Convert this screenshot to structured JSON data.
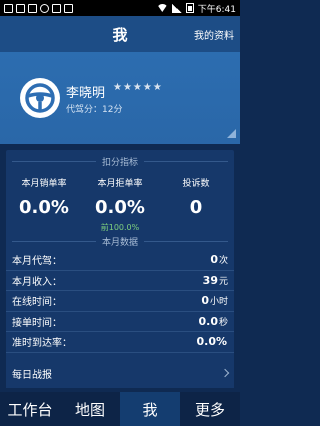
{
  "status_bar": {
    "time": "下午6:41"
  },
  "header": {
    "title": "我",
    "right_link": "我的资料"
  },
  "profile": {
    "name": "李晓明",
    "stars": "★★★★★",
    "score": "代驾分：12分"
  },
  "deduction_section": {
    "title": "扣分指标",
    "metrics": [
      {
        "label": "本月销单率",
        "value": "0.0%",
        "sub": ""
      },
      {
        "label": "本月拒单率",
        "value": "0.0%",
        "sub": "前100.0%"
      },
      {
        "label": "投诉数",
        "value": "0",
        "sub": ""
      }
    ]
  },
  "monthly_section": {
    "title": "本月数据",
    "rows": [
      {
        "label": "本月代驾：",
        "value": "0",
        "unit": "次"
      },
      {
        "label": "本月收入：",
        "value": "39",
        "unit": "元"
      },
      {
        "label": "在线时间：",
        "value": "0",
        "unit": "小时"
      },
      {
        "label": "接单时间：",
        "value": "0.0",
        "unit": "秒"
      },
      {
        "label": "准时到达率：",
        "value": "0.0%",
        "unit": ""
      }
    ]
  },
  "daily_report": {
    "label": "每日战报"
  },
  "tabs": [
    {
      "label": "工作台"
    },
    {
      "label": "地图"
    },
    {
      "label": "我"
    },
    {
      "label": "更多"
    }
  ]
}
